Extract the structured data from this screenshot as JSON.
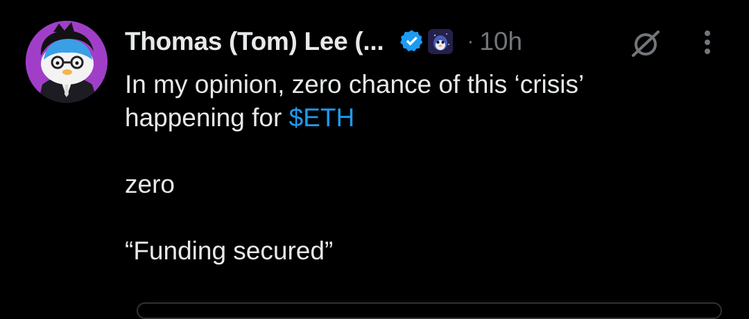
{
  "tweet": {
    "author": {
      "display_name": "Thomas (Tom) Lee (...",
      "verified_icon": "verified-badge-icon",
      "affiliate_icon": "affiliate-badge-icon",
      "avatar": "penguin-avatar"
    },
    "separator": "·",
    "timestamp": "10h",
    "grok_icon": "grok-icon",
    "more_icon": "more-options-icon",
    "text": {
      "line1": "In my opinion, zero chance of this ‘crisis’",
      "line2_prefix": "happening for ",
      "cashtag": "$ETH",
      "line3": "zero",
      "line4": "“Funding secured”"
    }
  },
  "colors": {
    "background": "#000000",
    "text": "#e7e9ea",
    "muted": "#71767b",
    "link": "#1d9bf0",
    "verified": "#1d9bf0",
    "avatar_bg": "#a03ec8"
  }
}
